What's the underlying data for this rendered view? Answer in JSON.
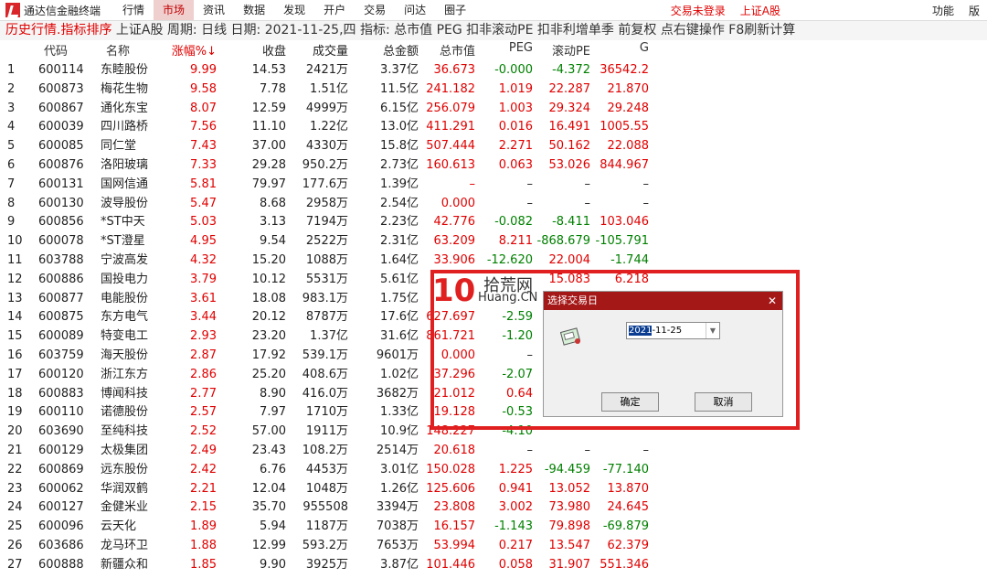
{
  "menubar": {
    "app_title": "通达信金融终端",
    "items": [
      "行情",
      "市场",
      "资讯",
      "数据",
      "发现",
      "开户",
      "交易",
      "问达",
      "圈子"
    ],
    "active": "市场",
    "right": {
      "login": "交易未登录",
      "market": "上证A股",
      "function": "功能",
      "version": "版"
    }
  },
  "toolbar": {
    "history": "历史行情.指标排序",
    "info": " 上证A股 周期: 日线 日期: 2021-11-25,四 指标: 总市值 PEG 扣非滚动PE 扣非利增单季  前复权 点右键操作 F8刷新计算"
  },
  "table": {
    "headers": {
      "code": "代码",
      "name": "名称",
      "chg": "涨幅%↓",
      "price": "收盘",
      "vol": "成交量",
      "amount": "总金额",
      "cap": "总市值",
      "peg": "PEG",
      "pe": "滚动PE",
      "g": "G"
    },
    "rows": [
      [
        "1",
        "600114",
        "东睦股份",
        "9.99",
        "14.53",
        "2421万",
        "3.37亿",
        "36.673",
        "-0.000",
        "-4.372",
        "36542.2"
      ],
      [
        "2",
        "600873",
        "梅花生物",
        "9.58",
        "7.78",
        "1.51亿",
        "11.5亿",
        "241.182",
        "1.019",
        "22.287",
        "21.870"
      ],
      [
        "3",
        "600867",
        "通化东宝",
        "8.07",
        "12.59",
        "4999万",
        "6.15亿",
        "256.079",
        "1.003",
        "29.324",
        "29.248"
      ],
      [
        "4",
        "600039",
        "四川路桥",
        "7.56",
        "11.10",
        "1.22亿",
        "13.0亿",
        "411.291",
        "0.016",
        "16.491",
        "1005.55"
      ],
      [
        "5",
        "600085",
        "同仁堂",
        "7.43",
        "37.00",
        "4330万",
        "15.8亿",
        "507.444",
        "2.271",
        "50.162",
        "22.088"
      ],
      [
        "6",
        "600876",
        "洛阳玻璃",
        "7.33",
        "29.28",
        "950.2万",
        "2.73亿",
        "160.613",
        "0.063",
        "53.026",
        "844.967"
      ],
      [
        "7",
        "600131",
        "国网信通",
        "5.81",
        "79.97",
        "177.6万",
        "1.39亿",
        "–",
        "–",
        "–",
        "–"
      ],
      [
        "8",
        "600130",
        "波导股份",
        "5.47",
        "8.68",
        "2958万",
        "2.54亿",
        "0.000",
        "–",
        "–",
        "–"
      ],
      [
        "9",
        "600856",
        "*ST中天",
        "5.03",
        "3.13",
        "7194万",
        "2.23亿",
        "42.776",
        "-0.082",
        "-8.411",
        "103.046"
      ],
      [
        "10",
        "600078",
        "*ST澄星",
        "4.95",
        "9.54",
        "2522万",
        "2.31亿",
        "63.209",
        "8.211",
        "-868.679",
        "-105.791"
      ],
      [
        "11",
        "603788",
        "宁波高发",
        "4.32",
        "15.20",
        "1088万",
        "1.64亿",
        "33.906",
        "-12.620",
        "22.004",
        "-1.744"
      ],
      [
        "12",
        "600886",
        "国投电力",
        "3.79",
        "10.12",
        "5531万",
        "5.61亿",
        "",
        "",
        "15.083",
        "6.218"
      ],
      [
        "13",
        "600877",
        "电能股份",
        "3.61",
        "18.08",
        "983.1万",
        "1.75亿",
        "",
        "",
        "",
        ""
      ],
      [
        "14",
        "600875",
        "东方电气",
        "3.44",
        "20.12",
        "8787万",
        "17.6亿",
        "627.697",
        "-2.59",
        "",
        ""
      ],
      [
        "15",
        "600089",
        "特变电工",
        "2.93",
        "23.20",
        "1.37亿",
        "31.6亿",
        "861.721",
        "-1.20",
        "",
        ""
      ],
      [
        "16",
        "603759",
        "海天股份",
        "2.87",
        "17.92",
        "539.1万",
        "9601万",
        "0.000",
        "–",
        "",
        ""
      ],
      [
        "17",
        "600120",
        "浙江东方",
        "2.86",
        "25.20",
        "408.6万",
        "1.02亿",
        "37.296",
        "-2.07",
        "",
        ""
      ],
      [
        "18",
        "600883",
        "博闻科技",
        "2.77",
        "8.90",
        "416.0万",
        "3682万",
        "21.012",
        "0.64",
        "",
        ""
      ],
      [
        "19",
        "600110",
        "诺德股份",
        "2.57",
        "7.97",
        "1710万",
        "1.33亿",
        "19.128",
        "-0.53",
        "",
        ""
      ],
      [
        "20",
        "603690",
        "至纯科技",
        "2.52",
        "57.00",
        "1911万",
        "10.9亿",
        "148.227",
        "-4.10",
        "",
        ""
      ],
      [
        "21",
        "600129",
        "太极集团",
        "2.49",
        "23.43",
        "108.2万",
        "2514万",
        "20.618",
        "–",
        "–",
        "–"
      ],
      [
        "22",
        "600869",
        "远东股份",
        "2.42",
        "6.76",
        "4453万",
        "3.01亿",
        "150.028",
        "1.225",
        "-94.459",
        "-77.140"
      ],
      [
        "23",
        "600062",
        "华润双鹤",
        "2.21",
        "12.04",
        "1048万",
        "1.26亿",
        "125.606",
        "0.941",
        "13.052",
        "13.870"
      ],
      [
        "24",
        "600127",
        "金健米业",
        "2.15",
        "35.70",
        "955508",
        "3394万",
        "23.808",
        "3.002",
        "73.980",
        "24.645"
      ],
      [
        "25",
        "600096",
        "云天化",
        "1.89",
        "5.94",
        "1187万",
        "7038万",
        "16.157",
        "-1.143",
        "79.898",
        "-69.879"
      ],
      [
        "26",
        "603686",
        "龙马环卫",
        "1.88",
        "12.99",
        "593.2万",
        "7653万",
        "53.994",
        "0.217",
        "13.547",
        "62.379"
      ],
      [
        "27",
        "600888",
        "新疆众和",
        "1.85",
        "9.90",
        "3925万",
        "3.87亿",
        "101.446",
        "0.058",
        "31.907",
        "551.346"
      ]
    ]
  },
  "dialog": {
    "title": "选择交易日",
    "date_sel": "2021",
    "date_rest": "-11-25",
    "ok": "确定",
    "cancel": "取消"
  },
  "watermark": {
    "logo": "10",
    "t1": "拾荒网",
    "t2": "Huang.CN"
  }
}
